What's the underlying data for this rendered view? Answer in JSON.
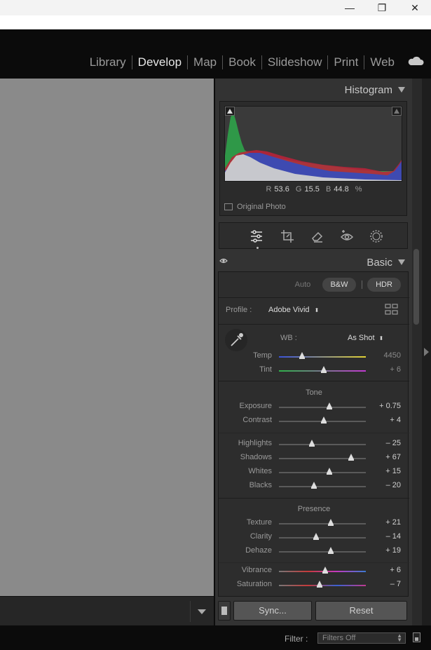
{
  "window": {
    "controls": {
      "minimize": "—",
      "maximize": "❐",
      "close": "✕"
    }
  },
  "modules": [
    "Library",
    "Develop",
    "Map",
    "Book",
    "Slideshow",
    "Print",
    "Web"
  ],
  "active_module": "Develop",
  "histogram": {
    "title": "Histogram",
    "rgb": {
      "r_label": "R",
      "r": "53.6",
      "g_label": "G",
      "g": "15.5",
      "b_label": "B",
      "b": "44.8",
      "unit": "%"
    },
    "original_photo": "Original Photo"
  },
  "tools": [
    "sliders-icon",
    "crop-icon",
    "eraser-icon",
    "redeye-icon",
    "masking-icon"
  ],
  "basic": {
    "title": "Basic",
    "buttons": {
      "auto": "Auto",
      "bw": "B&W",
      "hdr": "HDR"
    },
    "profile_label": "Profile :",
    "profile_value": "Adobe Vivid",
    "wb_label": "WB :",
    "wb_value": "As Shot",
    "tone_label": "Tone",
    "presence_label": "Presence",
    "sliders": {
      "temp": {
        "label": "Temp",
        "value": "4450",
        "level": 0.27
      },
      "tint": {
        "label": "Tint",
        "value": "+ 6",
        "level": 0.52
      },
      "exposure": {
        "label": "Exposure",
        "value": "+ 0.75",
        "level": 0.58
      },
      "contrast": {
        "label": "Contrast",
        "value": "+ 4",
        "level": 0.52
      },
      "highlights": {
        "label": "Highlights",
        "value": "– 25",
        "level": 0.38
      },
      "shadows": {
        "label": "Shadows",
        "value": "+ 67",
        "level": 0.83
      },
      "whites": {
        "label": "Whites",
        "value": "+ 15",
        "level": 0.58
      },
      "blacks": {
        "label": "Blacks",
        "value": "– 20",
        "level": 0.4
      },
      "texture": {
        "label": "Texture",
        "value": "+ 21",
        "level": 0.6
      },
      "clarity": {
        "label": "Clarity",
        "value": "– 14",
        "level": 0.43
      },
      "dehaze": {
        "label": "Dehaze",
        "value": "+ 19",
        "level": 0.6
      },
      "vibrance": {
        "label": "Vibrance",
        "value": "+ 6",
        "level": 0.53
      },
      "saturation": {
        "label": "Saturation",
        "value": "– 7",
        "level": 0.47
      }
    }
  },
  "buttons": {
    "sync": "Sync...",
    "reset": "Reset"
  },
  "footer": {
    "filter_label": "Filter :",
    "filter_value": "Filters Off"
  }
}
